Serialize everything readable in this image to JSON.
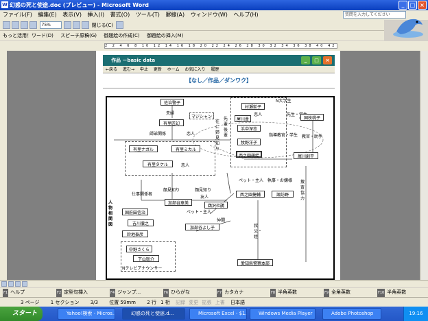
{
  "window": {
    "title": "幻惑の死と使途.doc (プレビュー) - Microsoft Word",
    "help_placeholder": "質問を入力してください"
  },
  "menu": [
    "ファイル(F)",
    "編集(E)",
    "表示(V)",
    "挿入(I)",
    "書式(O)",
    "ツール(T)",
    "罫線(A)",
    "ウィンドウ(W)",
    "ヘルプ(H)"
  ],
  "toolbar": {
    "zoom": "75%",
    "close_label": "閉じる(C)"
  },
  "toolbar2": {
    "more": "もっと活用！ワード(D)",
    "speech": "スピーチ原稿(G)",
    "greeting_create": "御題絵の作成(C)",
    "greeting_insert": "御題絵の挿入(M)"
  },
  "ruler": {
    "ticks": "2 2 4 6 8 10 12 14 16 18 20 22 24 26 28 30 32 34 36 38 40 42 44 46 48 50 52"
  },
  "web": {
    "title": "作品 －basic data",
    "nav": [
      "←戻る",
      "進む→",
      "中止",
      "更新",
      "ホーム",
      "お気に入り",
      "履歴"
    ],
    "heading": "【なし／作品／ダンワク】"
  },
  "diagram": {
    "boxes": {
      "sato": "佐治警子",
      "arima_genji": "有里匠幻",
      "majishan": "マジシャン",
      "arima_nagaru": "有里ナガル",
      "arima_mikaru": "有里ミカル",
      "arima_takeru": "有里タケル",
      "muramatsu": "村瀬鉱子",
      "ya_kawa": "屋川晋",
      "hamanaka": "浜中深志",
      "makino": "牧野洋子",
      "nishinosono_moe": "西之園萌絵",
      "kunieda": "国枝桃子",
      "saikawa": "犀川創平",
      "nishinosono_kyo": "西之園捷輔",
      "mizuhara": "諏訪野",
      "kaga": "加部谷恵美",
      "uezawa": "鵜沢杜鵑",
      "kagaya_yoshiko": "加部谷よし子",
      "tonoike": "国府田信治",
      "yoshikawa": "吉川徹之",
      "suzuki": "鈴地泰彦",
      "nakano": "中野さくら",
      "shimoyama": "下山聡介",
      "aichi": "愛知県警察本部"
    },
    "labels": {
      "n_univ": "N大学生",
      "couple": "夫婦",
      "apprentice": "師弟関係",
      "lover": "恋人",
      "lover2": "恋人",
      "senior": "先輩・後輩",
      "inverse": "往に姉見知り",
      "teacher": "先生・学生",
      "advisor": "指導教官・学生",
      "prof": "教官・助手",
      "knows": "顔見知り",
      "manager": "仕事関係者",
      "acquaint": "顔見知り",
      "friend": "友人",
      "pet": "ペット・主人",
      "pet2": "ペット・主人",
      "staff": "執事・お嬢様",
      "parent": "仲間",
      "uncle": "叔父・姪",
      "investigate": "捜査協力",
      "kanji_side": "人物相関図",
      "tv": "Nテレビアナウンサー",
      "love_dashed": "恋人"
    }
  },
  "fkeys": [
    {
      "key": "F1",
      "label": "ヘルプ"
    },
    {
      "key": "F2",
      "label": "定型句挿入"
    },
    {
      "key": "F4",
      "label": "ジャンプ..."
    },
    {
      "key": "F6",
      "label": "ひらがな"
    },
    {
      "key": "F7",
      "label": "カタカナ"
    },
    {
      "key": "F8",
      "label": "半角英数"
    },
    {
      "key": "F9",
      "label": "全角英数"
    },
    {
      "key": "F10",
      "label": "半角英数"
    }
  ],
  "status": {
    "page": "3 ページ",
    "section": "1 セクション",
    "pages": "3/3",
    "position": "位置 59mm",
    "line": "2 行",
    "col": "1 桁",
    "rec": "記録",
    "trk": "変更",
    "ext": "拡張",
    "ovr": "上書",
    "lang": "日本語"
  },
  "taskbar": {
    "start": "スタート",
    "tasks": [
      "Yahoo!検索 - Micros...",
      "幻惑の死と使途.d...",
      "Microsoft Excel - $1...",
      "Windows Media Player",
      "Adobe Photoshop"
    ],
    "clock": "19:16"
  }
}
